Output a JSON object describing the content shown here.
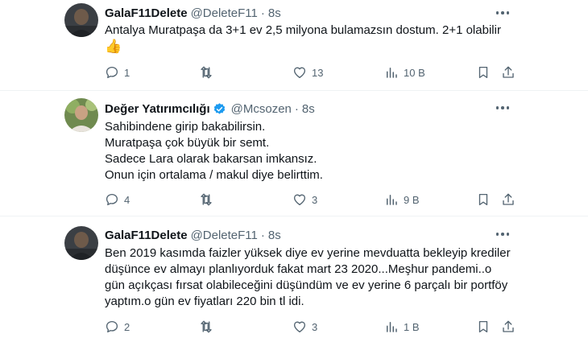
{
  "tweets": [
    {
      "name": "GalaF11Delete",
      "handle": "@DeleteF11",
      "separator": "·",
      "time": "8s",
      "verified": false,
      "lines": [
        "Antalya Muratpaşa da 3+1 ev 2,5 milyona bulamazsın dostum. 2+1 olabilir",
        "👍"
      ],
      "replies": "1",
      "retweets": "",
      "likes": "13",
      "views": "10 B"
    },
    {
      "name": "Değer Yatırımcılığı",
      "handle": "@Mcsozen",
      "separator": "·",
      "time": "8s",
      "verified": true,
      "lines": [
        "Sahibindene girip bakabilirsin.",
        "Muratpaşa çok büyük bir semt.",
        "Sadece Lara olarak bakarsan imkansız.",
        "Onun için ortalama / makul diye belirttim."
      ],
      "replies": "4",
      "retweets": "",
      "likes": "3",
      "views": "9 B"
    },
    {
      "name": "GalaF11Delete",
      "handle": "@DeleteF11",
      "separator": "·",
      "time": "8s",
      "verified": false,
      "lines": [
        "Ben 2019 kasımda faizler yüksek diye ev yerine mevduatta bekleyip krediler",
        "düşünce ev almayı planlıyorduk fakat mart 23 2020...Meşhur pandemi..o",
        "gün açıkçası fırsat olabileceğini düşündüm ve ev yerine 6 parçalı bir portföy",
        "yaptım.o gün ev fiyatları 220 bin tl idi."
      ],
      "replies": "2",
      "retweets": "",
      "likes": "3",
      "views": "1 B"
    }
  ],
  "colors": {
    "text": "#0f1419",
    "secondary": "#536471",
    "verified": "#1d9bf0",
    "divider": "#eff3f4"
  },
  "icons": {
    "reply": "reply-icon",
    "retweet": "retweet-icon",
    "like": "heart-icon",
    "views": "views-chart-icon",
    "bookmark": "bookmark-icon",
    "share": "share-icon"
  }
}
